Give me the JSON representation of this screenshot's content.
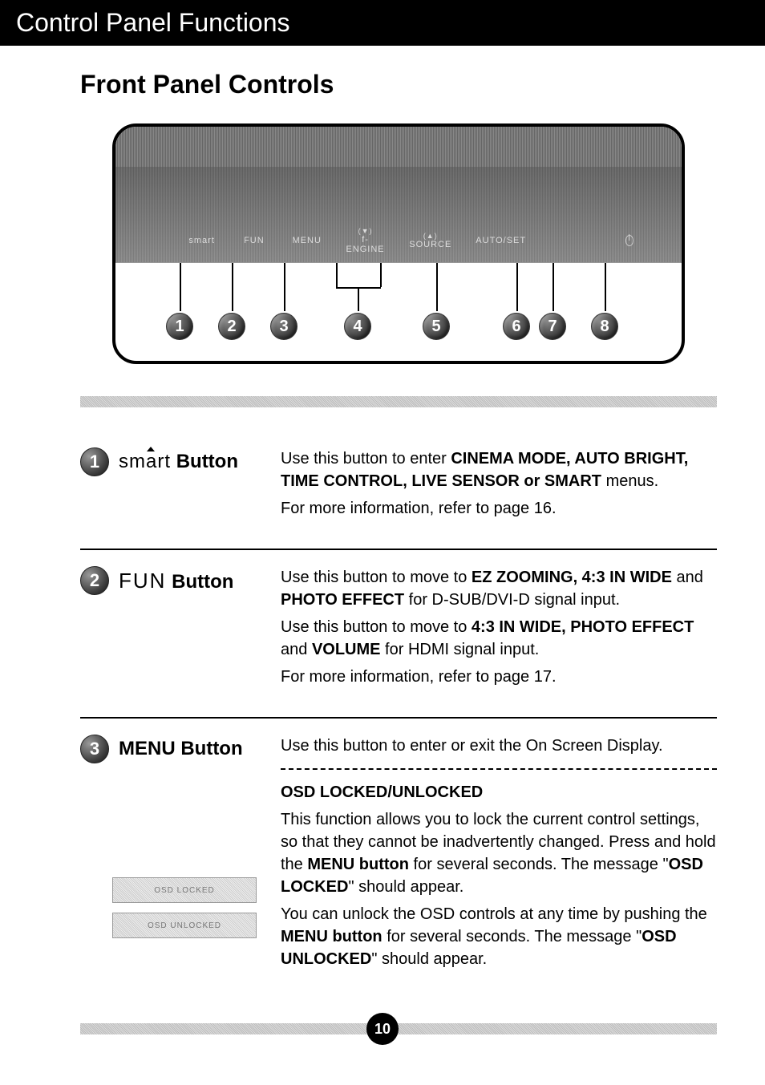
{
  "header": "Control Panel Functions",
  "section_title": "Front Panel Controls",
  "diagram": {
    "button_labels": [
      "smart",
      "FUN",
      "MENU",
      "f-ENGINE",
      "SOURCE",
      "AUTO/SET"
    ],
    "engine_arrow": "(▼)",
    "source_arrow": "(▲)",
    "numbers": [
      "1",
      "2",
      "3",
      "4",
      "5",
      "6",
      "7",
      "8"
    ]
  },
  "items": [
    {
      "num": "1",
      "title_prefix": "sm",
      "title_hat": "a",
      "title_suffix": "rt",
      "title_bold": " Button",
      "desc_parts": [
        {
          "t": "Use this button to enter "
        },
        {
          "t": "CINEMA MODE, AUTO BRIGHT, TIME CONTROL, LIVE SENSOR or SMART",
          "b": true
        },
        {
          "t": " menus."
        }
      ],
      "more": "For more information, refer to page 16."
    },
    {
      "num": "2",
      "fun_title": "FUN",
      "title_bold": " Button",
      "desc1_parts": [
        {
          "t": "Use this button to move to "
        },
        {
          "t": "EZ ZOOMING, 4:3 IN WIDE",
          "b": true
        },
        {
          "t": " and "
        },
        {
          "t": "PHOTO EFFECT",
          "b": true
        },
        {
          "t": " for D-SUB/DVI-D signal input."
        }
      ],
      "desc2_parts": [
        {
          "t": "Use this button to move to "
        },
        {
          "t": "4:3 IN WIDE, PHOTO EFFECT",
          "b": true
        },
        {
          "t": " and "
        },
        {
          "t": "VOLUME",
          "b": true
        },
        {
          "t": " for HDMI signal input."
        }
      ],
      "more": "For more information, refer to page 17."
    },
    {
      "num": "3",
      "menu_title": "MENU Button",
      "desc": "Use this button to enter or exit the On Screen Display.",
      "osd_heading": "OSD LOCKED/UNLOCKED",
      "osd_p1_parts": [
        {
          "t": "This function allows you to lock the current control settings, so that they cannot be inadvertently changed. Press and hold the "
        },
        {
          "t": "MENU button",
          "b": true
        },
        {
          "t": " for several seconds. The message \""
        },
        {
          "t": "OSD LOCKED",
          "b": true
        },
        {
          "t": "\" should appear."
        }
      ],
      "osd_p2_parts": [
        {
          "t": "You can unlock the OSD controls at any time by pushing the "
        },
        {
          "t": "MENU button",
          "b": true
        },
        {
          "t": " for several seconds. The message \""
        },
        {
          "t": "OSD UNLOCKED",
          "b": true
        },
        {
          "t": "\" should appear."
        }
      ],
      "box1": "OSD LOCKED",
      "box2": "OSD UNLOCKED"
    }
  ],
  "page_number": "10"
}
